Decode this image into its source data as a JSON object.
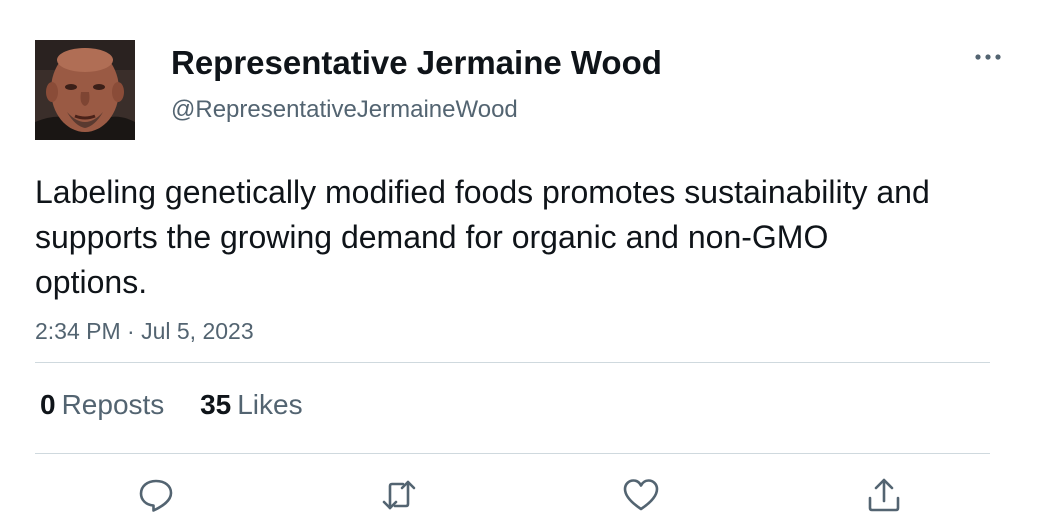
{
  "author": {
    "display_name": "Representative Jermaine Wood",
    "handle": "@RepresentativeJermaineWood"
  },
  "post": {
    "text": "Labeling genetically modified foods promotes sustainability and supports the growing demand for organic and non-GMO options.",
    "timestamp": "2:34 PM · Jul 5, 2023"
  },
  "stats": {
    "reposts_count": "0",
    "reposts_label": "Reposts",
    "likes_count": "35",
    "likes_label": "Likes"
  },
  "icons": {
    "more": "more-horizontal-icon",
    "reply": "reply-icon",
    "repost": "repost-icon",
    "like": "heart-icon",
    "share": "share-icon"
  },
  "colors": {
    "text_primary": "#0f1419",
    "text_secondary": "#536471",
    "divider": "#cfd9de"
  }
}
